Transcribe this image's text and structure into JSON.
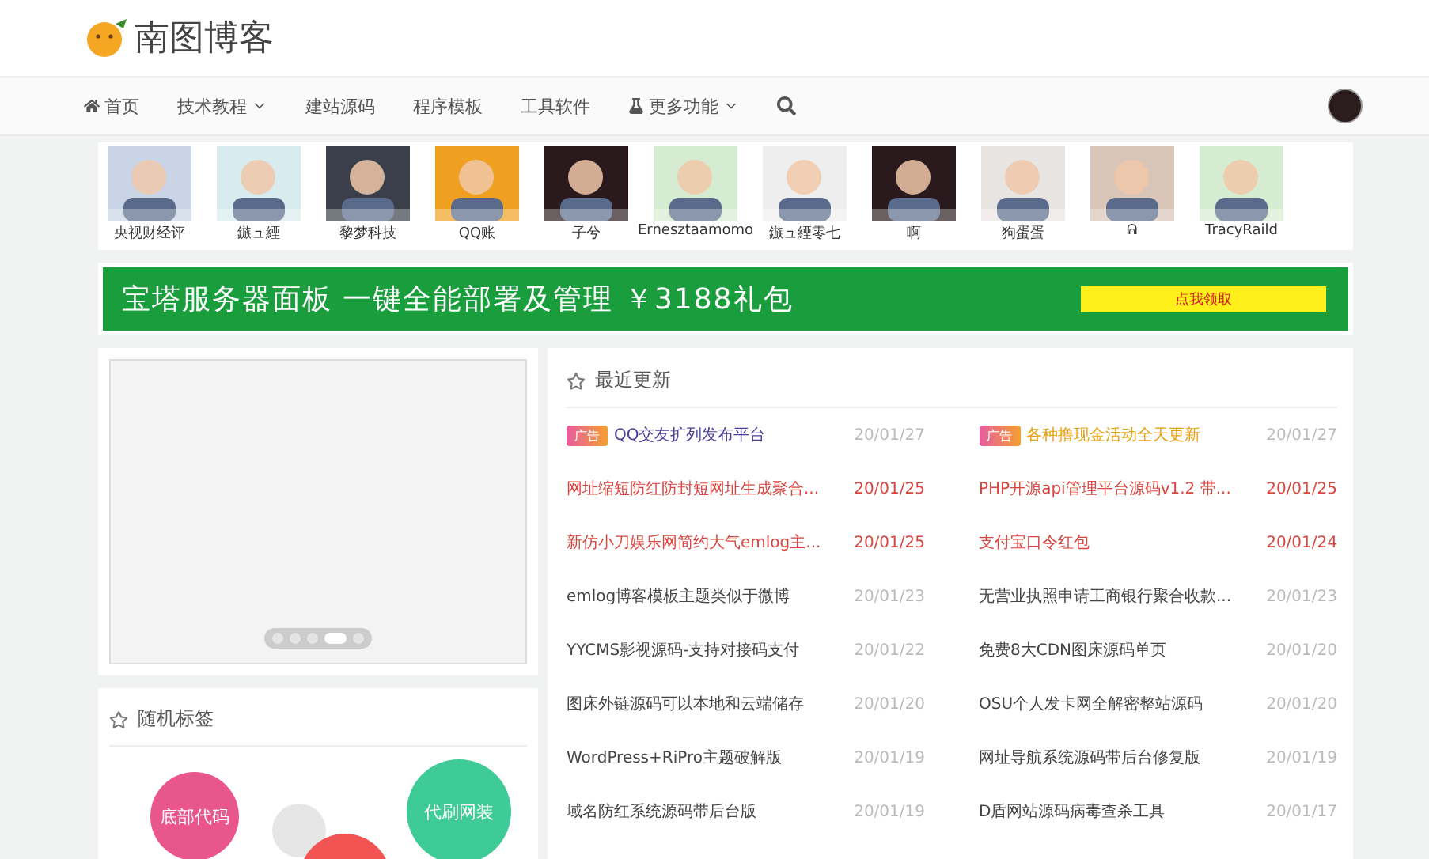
{
  "header": {
    "logo_text": "南图博客"
  },
  "nav": {
    "items": [
      {
        "label": "首页",
        "kind": "home"
      },
      {
        "label": "技术教程",
        "kind": "menu"
      },
      {
        "label": "建站源码",
        "kind": "link"
      },
      {
        "label": "程序模板",
        "kind": "link"
      },
      {
        "label": "工具软件",
        "kind": "link"
      },
      {
        "label": "更多功能",
        "kind": "lab"
      }
    ]
  },
  "visitors": [
    {
      "name": "央视财经评"
    },
    {
      "name": "鏃ュ緸"
    },
    {
      "name": "黎梦科技"
    },
    {
      "name": "QQ账"
    },
    {
      "name": "子兮"
    },
    {
      "name": "Ernesztaamomo"
    },
    {
      "name": "鏃ュ緸零七"
    },
    {
      "name": "啊"
    },
    {
      "name": "狗蛋蛋"
    },
    {
      "name": "ᕱ"
    },
    {
      "name": "TracyRaild"
    }
  ],
  "banner": {
    "text": "宝塔服务器面板 一键全能部署及管理 ￥3188礼包",
    "button": "点我领取"
  },
  "slider": {
    "dots": [
      {
        "selected": false
      },
      {
        "selected": false
      },
      {
        "selected": false
      },
      {
        "selected": true
      },
      {
        "selected": false
      }
    ]
  },
  "tags_panel": {
    "title": "随机标签",
    "tags": [
      {
        "label": "底部代码",
        "color": "#e8568c"
      },
      {
        "color": "#e6e6e6"
      },
      {
        "color": "#f25454"
      },
      {
        "label": "代刷网装",
        "color": "#3ecb98"
      }
    ]
  },
  "recent": {
    "title": "最近更新",
    "rows": [
      [
        {
          "kind": "ad",
          "badge": "广告",
          "title": "QQ交友扩列发布平台",
          "date": "20/01/27",
          "color": "#4a3f9a"
        },
        {
          "kind": "ad",
          "badge": "广告",
          "title": "各种撸现金活动全天更新",
          "date": "20/01/27",
          "color": "#e6a010"
        }
      ],
      [
        {
          "kind": "hot",
          "title": "网址缩短防红防封短网址生成聚合...",
          "date": "20/01/25"
        },
        {
          "kind": "hot",
          "title": "PHP开源api管理平台源码v1.2 带...",
          "date": "20/01/25"
        }
      ],
      [
        {
          "kind": "hot",
          "title": "新仿小刀娱乐网简约大气emlog主...",
          "date": "20/01/25"
        },
        {
          "kind": "hot",
          "title": "支付宝口令红包",
          "date": "20/01/24"
        }
      ],
      [
        {
          "kind": "normal",
          "title": "emlog博客模板主题类似于微博",
          "date": "20/01/23"
        },
        {
          "kind": "normal",
          "title": "无营业执照申请工商银行聚合收款...",
          "date": "20/01/23"
        }
      ],
      [
        {
          "kind": "normal",
          "title": "YYCMS影视源码-支持对接码支付",
          "date": "20/01/22"
        },
        {
          "kind": "normal",
          "title": "免费8大CDN图床源码单页",
          "date": "20/01/20"
        }
      ],
      [
        {
          "kind": "normal",
          "title": "图床外链源码可以本地和云端储存",
          "date": "20/01/20"
        },
        {
          "kind": "normal",
          "title": "OSU个人发卡网全解密整站源码",
          "date": "20/01/20"
        }
      ],
      [
        {
          "kind": "normal",
          "title": "WordPress+RiPro主题破解版",
          "date": "20/01/19"
        },
        {
          "kind": "normal",
          "title": "网址导航系统源码带后台修复版",
          "date": "20/01/19"
        }
      ],
      [
        {
          "kind": "normal",
          "title": "域名防红系统源码带后台版",
          "date": "20/01/19"
        },
        {
          "kind": "normal",
          "title": "D盾网站源码病毒查杀工具",
          "date": "20/01/17"
        }
      ]
    ]
  }
}
